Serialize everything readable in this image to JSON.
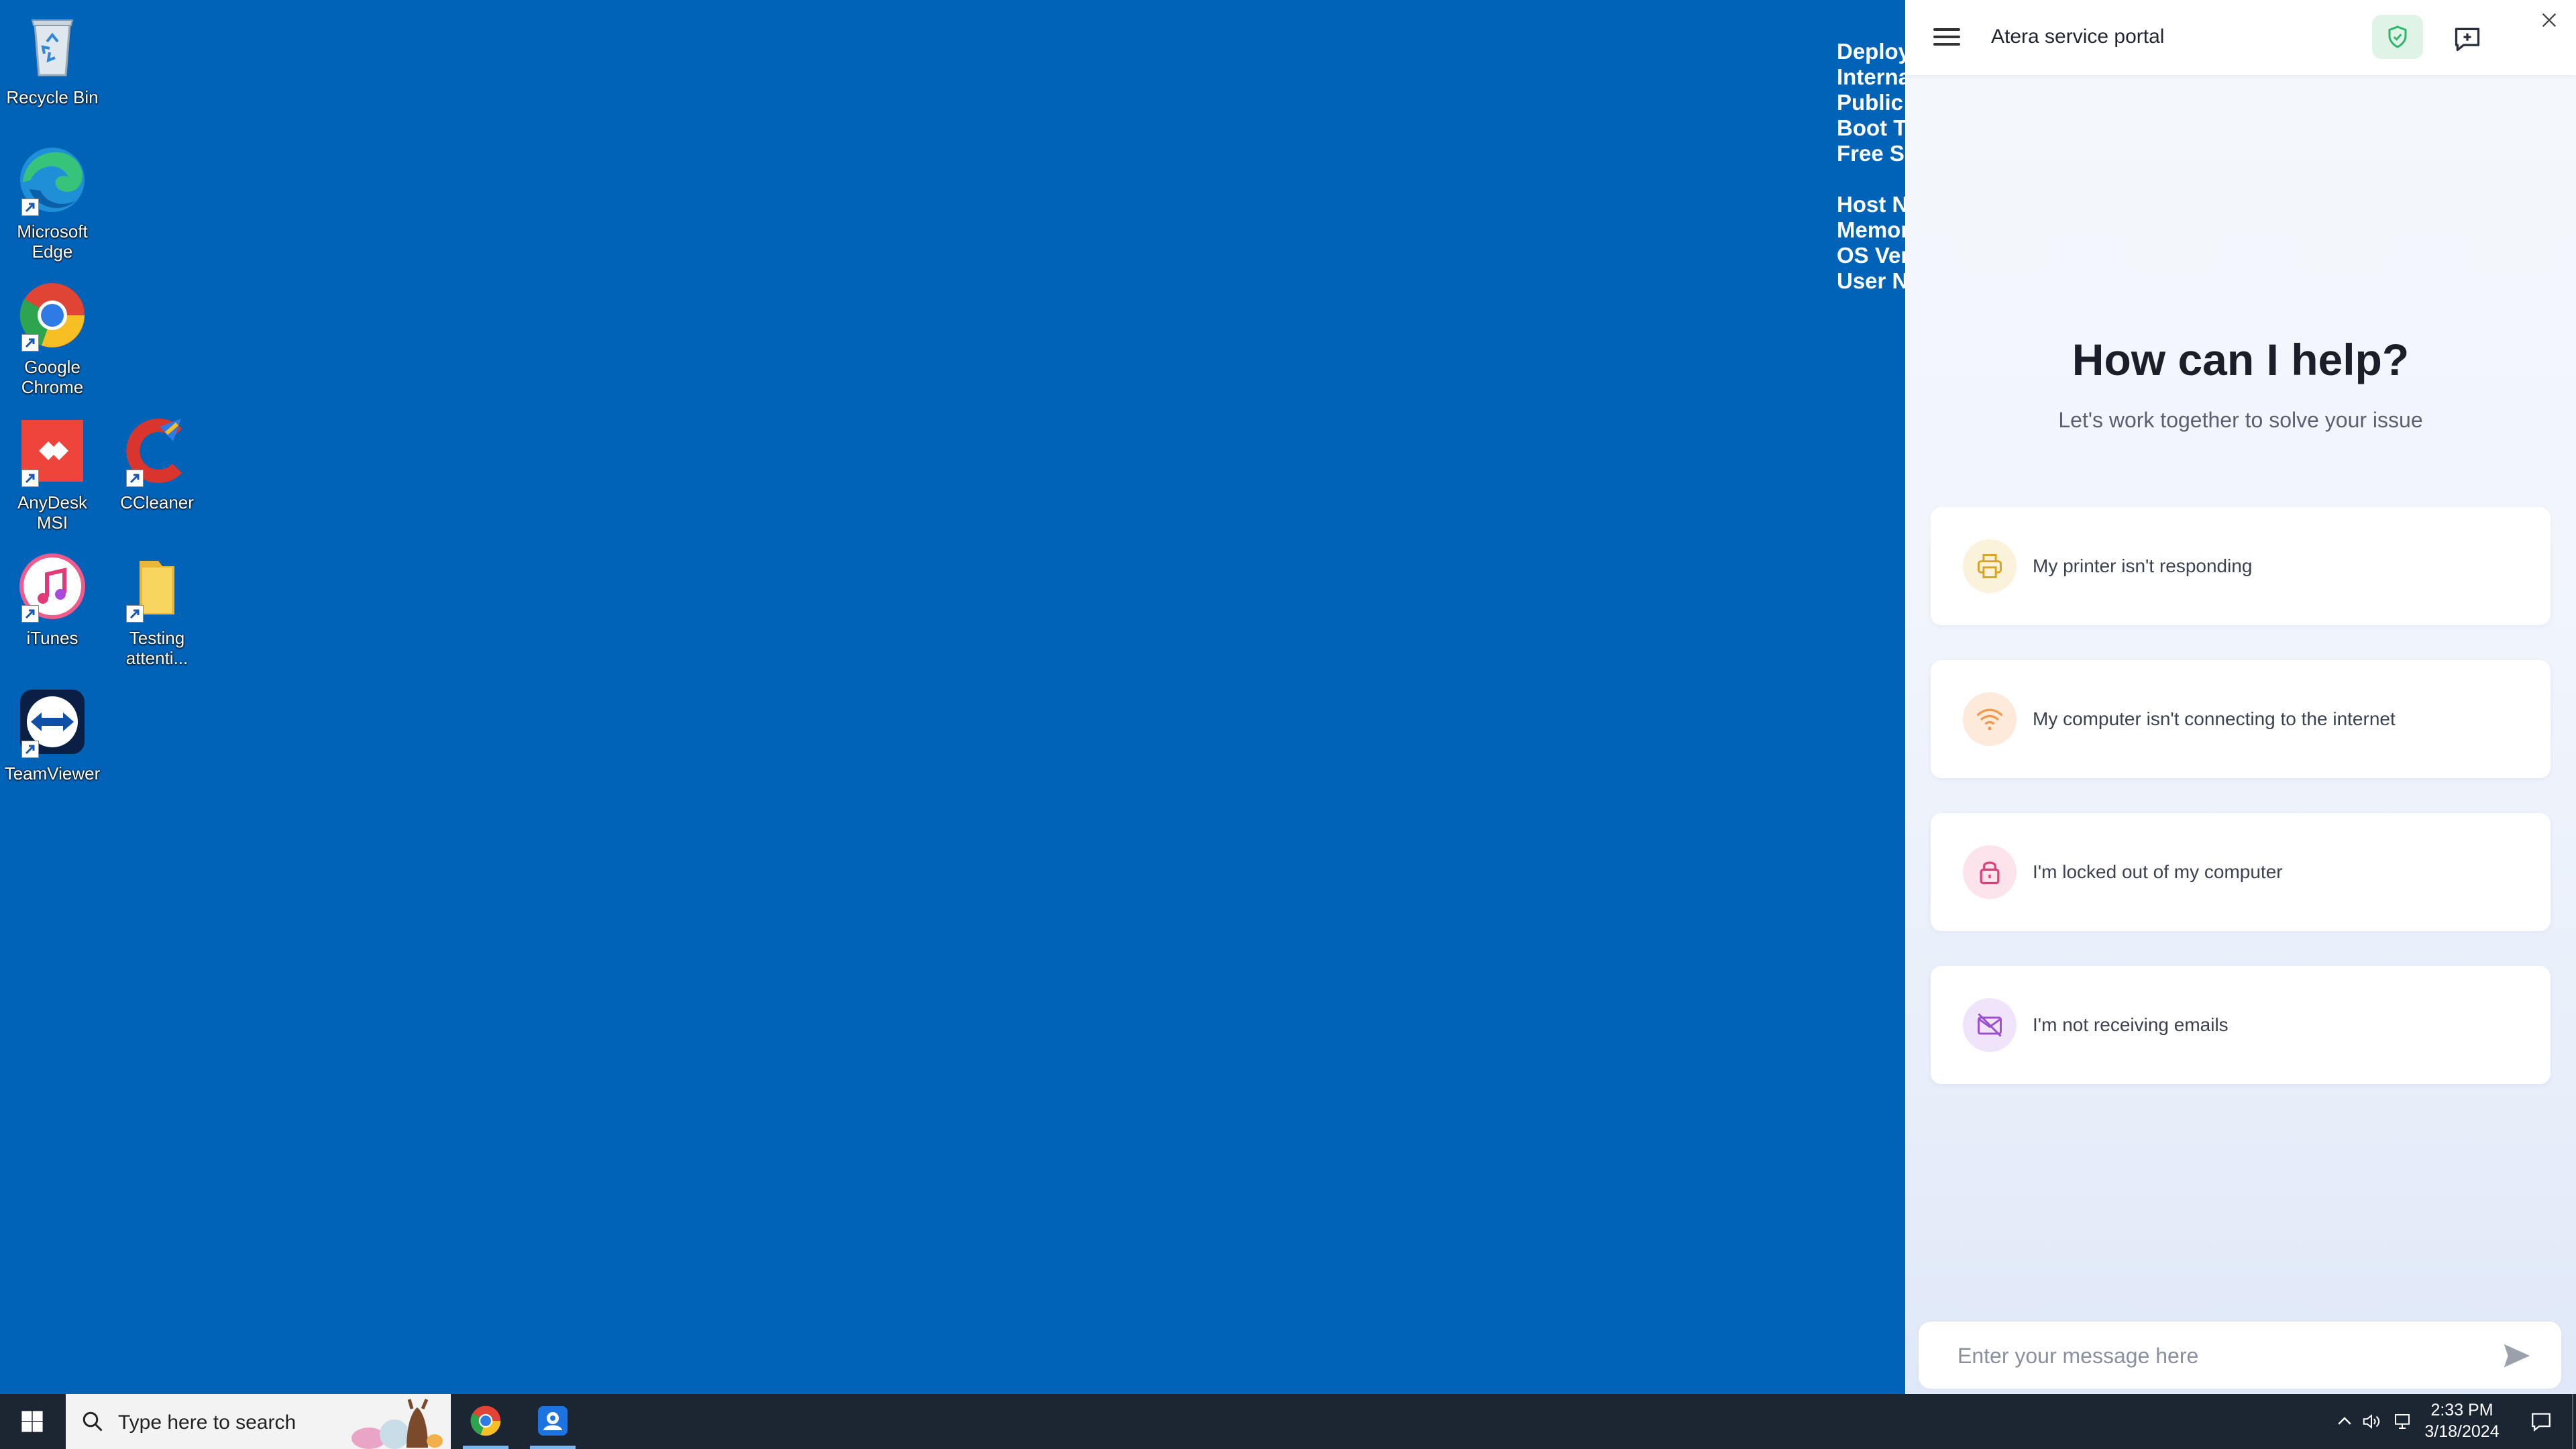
{
  "desktop": {
    "icons": [
      {
        "label": "Recycle Bin",
        "icon": "recycle-bin-icon"
      },
      {
        "label": "Microsoft Edge",
        "icon": "edge-icon"
      },
      {
        "label": "Google Chrome",
        "icon": "chrome-icon"
      },
      {
        "label": "AnyDesk MSI",
        "icon": "anydesk-icon"
      },
      {
        "label": "CCleaner",
        "icon": "ccleaner-icon"
      },
      {
        "label": "iTunes",
        "icon": "itunes-icon"
      },
      {
        "label": "Testing attenti...",
        "icon": "folder-icon"
      },
      {
        "label": "TeamViewer",
        "icon": "teamviewer-icon"
      }
    ],
    "sysinfo_lines": [
      "Deploy",
      "Interna",
      "Public",
      "Boot T",
      "Free S",
      "Host N",
      "Memor",
      "OS Ver",
      "User N"
    ]
  },
  "portal": {
    "title": "Atera service portal",
    "heading": "How can I help?",
    "subheading": "Let's work together to solve your issue",
    "topics": [
      {
        "label": "My printer isn't responding",
        "icon": "printer-icon",
        "color": "#d9a521",
        "bg": "#fbf2dc"
      },
      {
        "label": "My computer isn't connecting to the internet",
        "icon": "wifi-icon",
        "color": "#ef9a4a",
        "bg": "#fdeadb"
      },
      {
        "label": "I'm locked out of my computer",
        "icon": "lock-icon",
        "color": "#e0407a",
        "bg": "#fde3ec"
      },
      {
        "label": "I'm not receiving emails",
        "icon": "mail-off-icon",
        "color": "#9b4fd0",
        "bg": "#f0e4fa"
      }
    ],
    "message_placeholder": "Enter your message here",
    "accent_shield": "#2fb56a"
  },
  "taskbar": {
    "search_placeholder": "Type here to search",
    "time": "2:33 PM",
    "date": "3/18/2024"
  }
}
